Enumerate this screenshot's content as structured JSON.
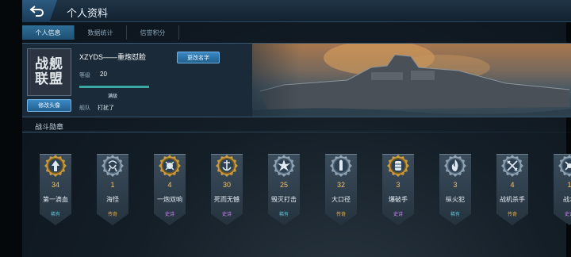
{
  "header": {
    "title": "个人资料"
  },
  "tabs": [
    {
      "label": "个人信息",
      "active": true
    },
    {
      "label": "数据统计",
      "active": false
    },
    {
      "label": "信誉积分",
      "active": false
    }
  ],
  "profile": {
    "avatar_text": [
      "战舰",
      "联盟"
    ],
    "avatar_button": "修改头像",
    "player_name": "XZYDS——重炮怼脸",
    "rename_button": "更改名字",
    "level_label": "等级",
    "level_value": "20",
    "xp_progress": 1.0,
    "xp_text": "满级",
    "fleet_label": "舰队",
    "fleet_value": "打扰了"
  },
  "medals_section": {
    "title": "战斗勋章",
    "items": [
      {
        "count": "34",
        "name": "第一滴血",
        "rarity": "稀有",
        "icon": "arrow-up-icon",
        "frame": "gold"
      },
      {
        "count": "1",
        "name": "海怪",
        "rarity": "传奇",
        "icon": "kraken-icon",
        "frame": "silver"
      },
      {
        "count": "4",
        "name": "一炮双响",
        "rarity": "史诗",
        "icon": "cannon-icon",
        "frame": "gold"
      },
      {
        "count": "30",
        "name": "死而无憾",
        "rarity": "史诗",
        "icon": "anchor-icon",
        "frame": "gold"
      },
      {
        "count": "25",
        "name": "毁灭打击",
        "rarity": "稀有",
        "icon": "explosion-icon",
        "frame": "silver"
      },
      {
        "count": "32",
        "name": "大口径",
        "rarity": "传奇",
        "icon": "shell-icon",
        "frame": "silver"
      },
      {
        "count": "3",
        "name": "爆破手",
        "rarity": "史诗",
        "icon": "barrel-icon",
        "frame": "gold"
      },
      {
        "count": "3",
        "name": "纵火犯",
        "rarity": "稀有",
        "icon": "flame-icon",
        "frame": "silver"
      },
      {
        "count": "4",
        "name": "战机杀手",
        "rarity": "传奇",
        "icon": "crossed-planes-icon",
        "frame": "silver"
      },
      {
        "count": "1",
        "name": "战术",
        "rarity": "史诗",
        "icon": "tactic-icon",
        "frame": "silver"
      }
    ]
  },
  "colors": {
    "accent": "#2f6f98",
    "legend": "#f0b23e",
    "epic": "#d487ff",
    "rare": "#57c8d9",
    "gold_count": "#f2c46a"
  }
}
